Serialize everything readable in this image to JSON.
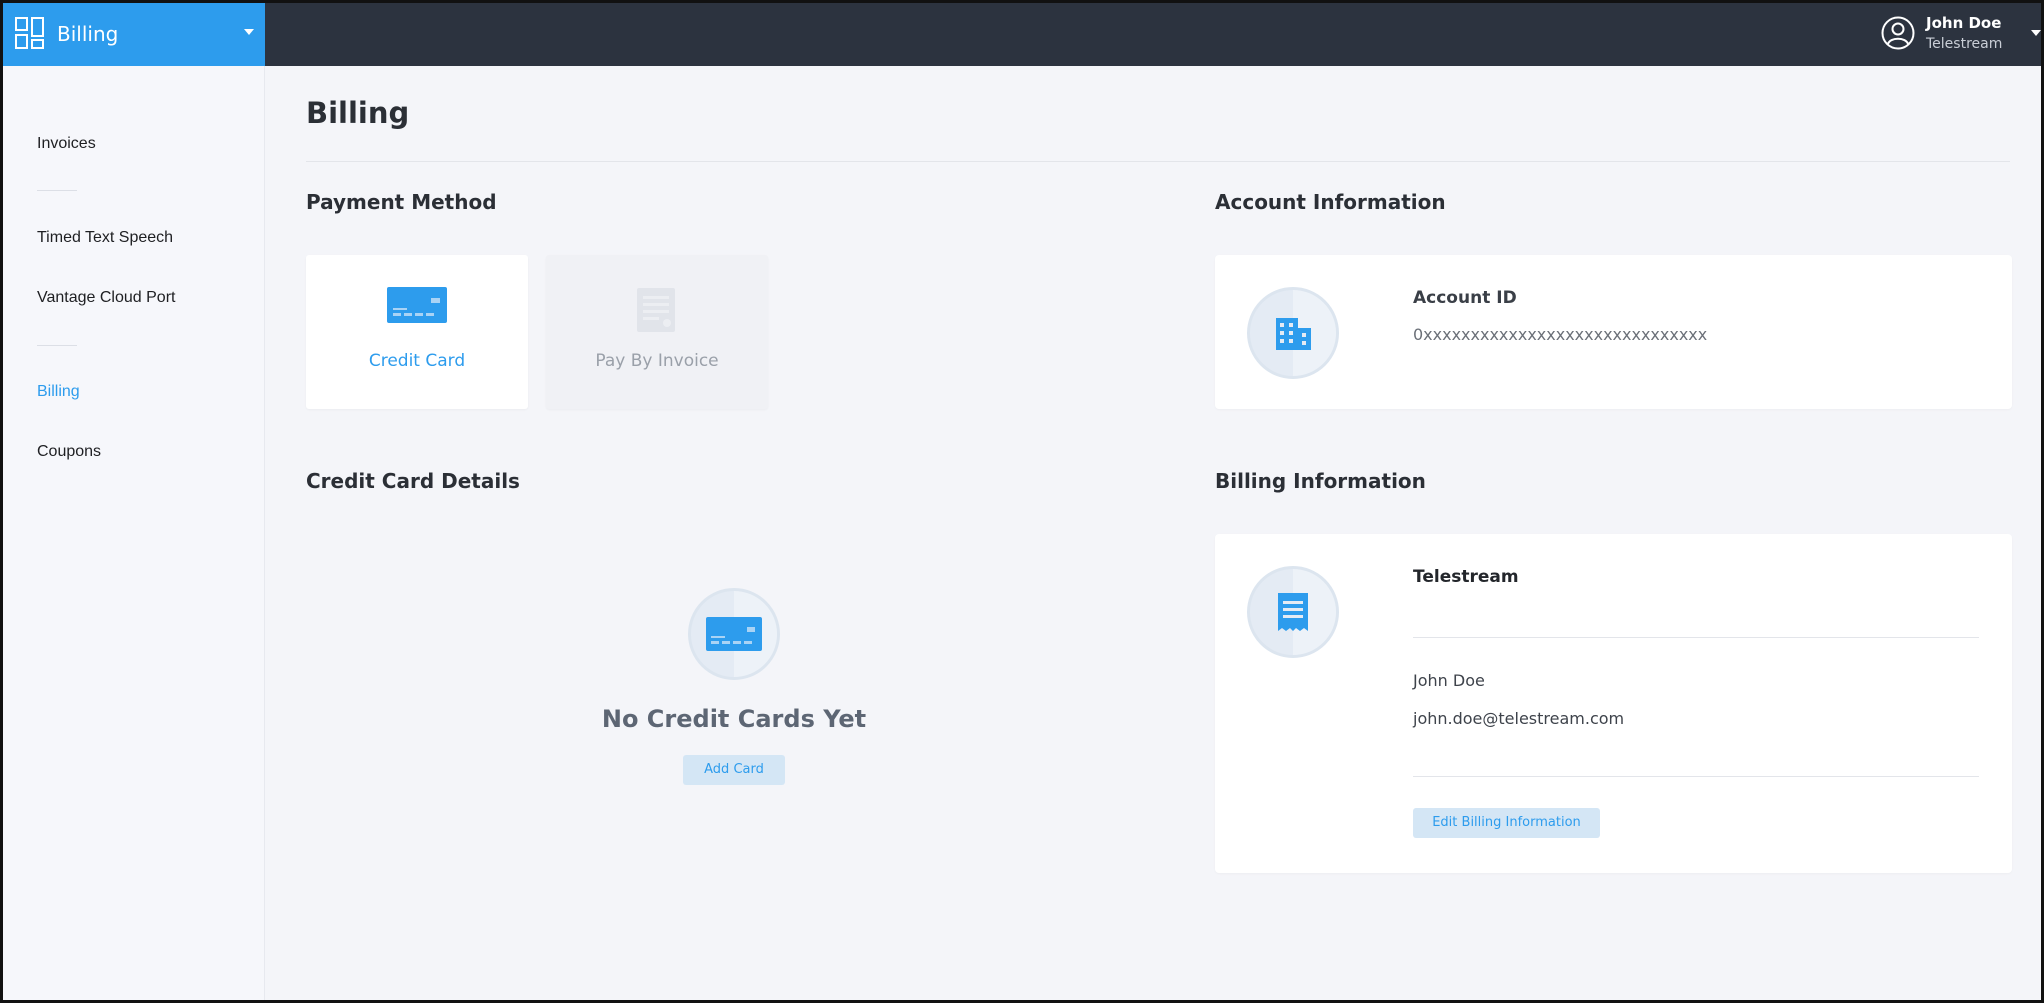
{
  "app": {
    "name": "Billing",
    "switcher_icon": "grid-icon"
  },
  "user": {
    "name": "John Doe",
    "organization": "Telestream",
    "icon": "user-circle-icon"
  },
  "sidebar": {
    "items": [
      {
        "label": "Invoices",
        "active": false
      },
      {
        "label": "Timed Text Speech",
        "active": false
      },
      {
        "label": "Vantage Cloud Port",
        "active": false
      },
      {
        "label": "Billing",
        "active": true
      },
      {
        "label": "Coupons",
        "active": false
      }
    ]
  },
  "page": {
    "title": "Billing"
  },
  "payment_method": {
    "title": "Payment Method",
    "options": [
      {
        "label": "Credit Card",
        "icon": "credit-card-icon",
        "selected": true
      },
      {
        "label": "Pay By Invoice",
        "icon": "invoice-icon",
        "selected": false
      }
    ]
  },
  "credit_card_details": {
    "title": "Credit Card Details",
    "empty_message": "No Credit Cards Yet",
    "add_button": "Add Card"
  },
  "account_information": {
    "title": "Account Information",
    "label": "Account ID",
    "value": "0xxxxxxxxxxxxxxxxxxxxxxxxxxxxxx",
    "icon": "building-icon"
  },
  "billing_information": {
    "title": "Billing Information",
    "company": "Telestream",
    "contact_name": "John Doe",
    "contact_email": "john.doe@telestream.com",
    "edit_button": "Edit Billing Information",
    "icon": "receipt-icon"
  },
  "colors": {
    "accent": "#2d9ced",
    "topbar": "#2c333f",
    "background": "#f4f5f9",
    "disabled_card": "#f0f1f5"
  }
}
